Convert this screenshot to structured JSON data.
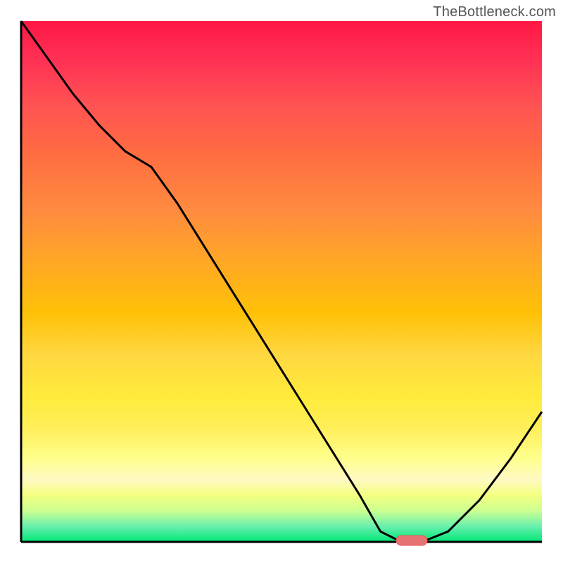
{
  "watermark": "TheBottleneck.com",
  "chart_data": {
    "type": "line",
    "title": "",
    "xlabel": "",
    "ylabel": "",
    "x": [
      0.0,
      0.05,
      0.1,
      0.15,
      0.2,
      0.25,
      0.3,
      0.35,
      0.4,
      0.45,
      0.5,
      0.55,
      0.6,
      0.65,
      0.69,
      0.73,
      0.77,
      0.82,
      0.88,
      0.94,
      1.0
    ],
    "values": [
      1.0,
      0.93,
      0.86,
      0.8,
      0.75,
      0.72,
      0.65,
      0.57,
      0.49,
      0.41,
      0.33,
      0.25,
      0.17,
      0.09,
      0.02,
      0.0,
      0.0,
      0.02,
      0.08,
      0.16,
      0.25
    ],
    "ylim": [
      0,
      1
    ],
    "xlim": [
      0,
      1
    ],
    "marker_x": 0.75,
    "background_gradient": {
      "top": "#ff1744",
      "mid": "#ffc107",
      "bottom": "#00e676"
    },
    "axes_visible": false,
    "grid": false
  }
}
